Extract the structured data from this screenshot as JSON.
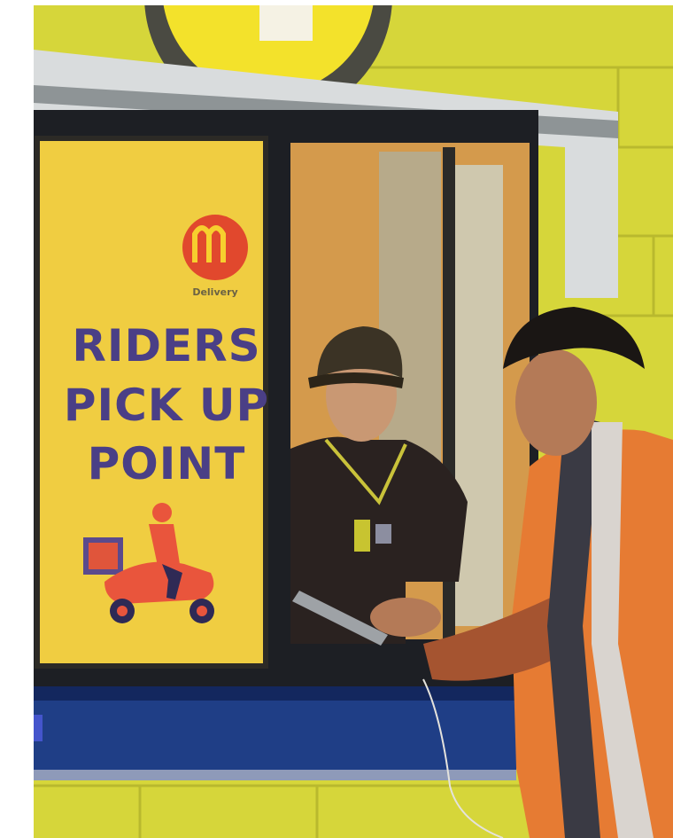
{
  "scene": {
    "poster": {
      "line1": "RIDERS",
      "line2": "PICK UP",
      "line3": "POINT",
      "delivery": "Delivery"
    },
    "colors": {
      "wall": "#d7d838",
      "poster_bg": "#f1cd3f",
      "poster_text": "#4a3f86",
      "counter": "#1f3f86",
      "jacket": "#e97c34"
    }
  }
}
